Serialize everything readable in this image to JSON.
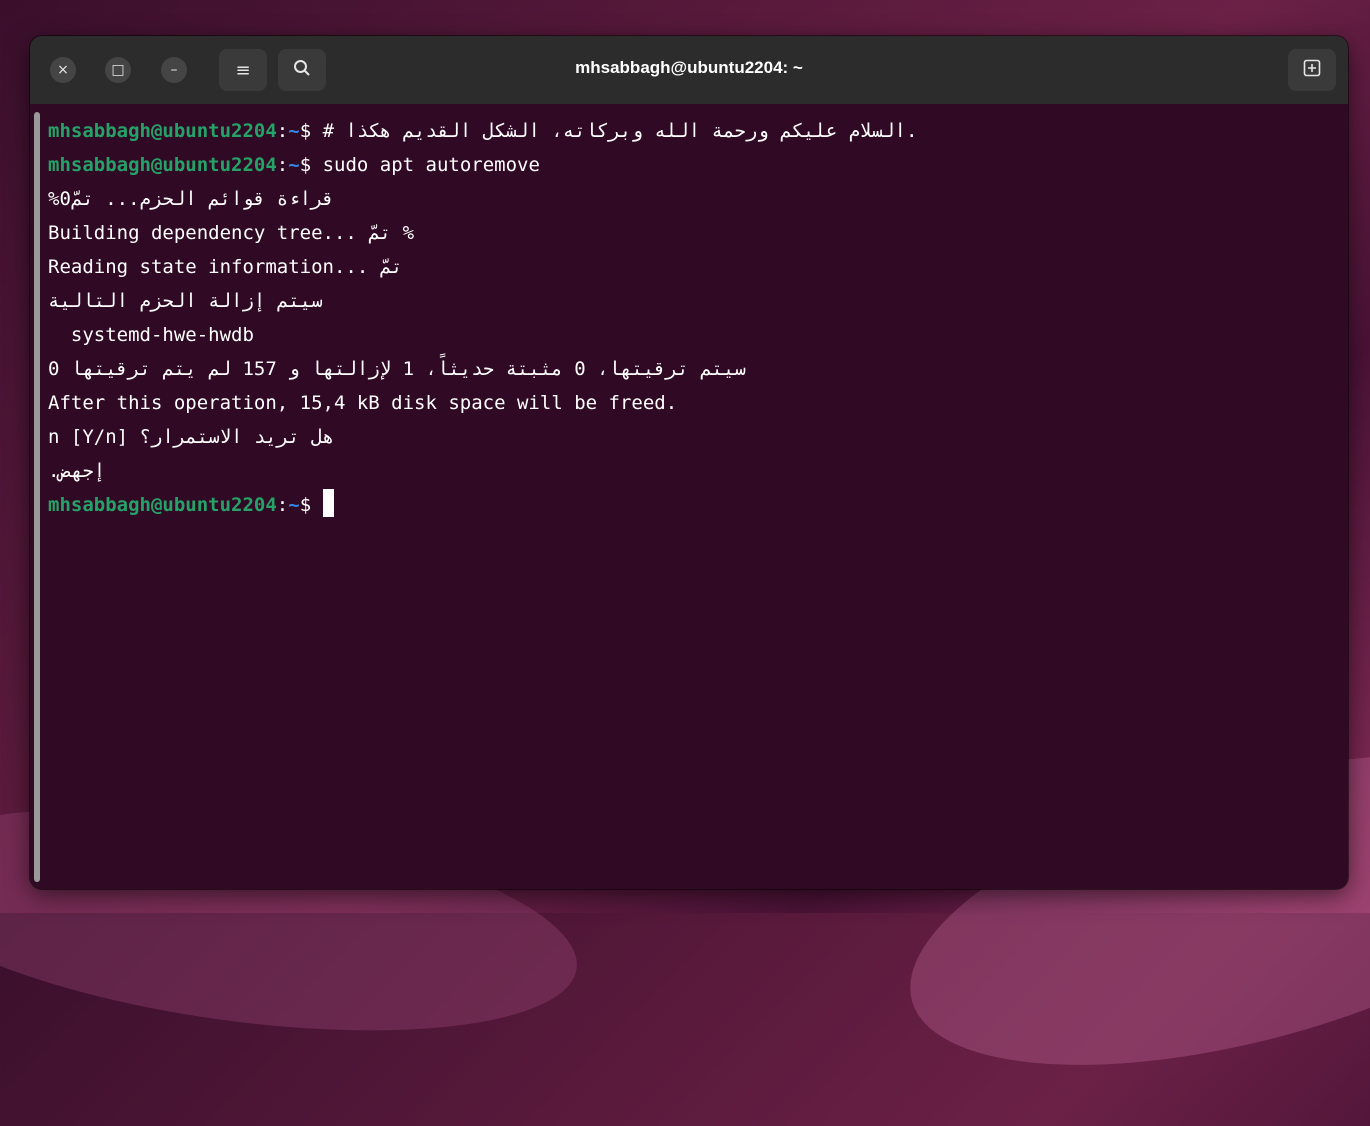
{
  "window": {
    "title": "mhsabbagh@ubuntu2204: ~",
    "buttons": {
      "close_icon": "×",
      "maximize_icon": "□",
      "minimize_icon": "–",
      "menu_icon": "≡",
      "search_icon": "⌕",
      "new_tab_icon": "⊞"
    }
  },
  "colors": {
    "terminal_bg": "#300a24",
    "titlebar_bg": "#2c2c2c",
    "prompt_user": "#26a269",
    "prompt_path": "#3584e4",
    "text": "#ffffff"
  },
  "terminal": {
    "prompt_user": "mhsabbagh@ubuntu2204",
    "prompt_sep": ":",
    "prompt_path": "~",
    "prompt_symbol": "$",
    "command1": " # السلام عليكم ورحمة الله وبركاته، الشكل القديم هكذا.",
    "command2": " sudo apt autoremove",
    "output": [
      "قراءة قوائم الحزم... تمّ0%",
      "Building dependency tree... تمّ %",
      "Reading state information... تمّ",
      "سيتم إزالة الحزم التالية",
      "  systemd-hwe-hwdb",
      "سيتم ترقيتها، 0 مثبتة حديثاً، 1 لإزالتها و 157 لم يتم ترقيتها 0",
      "After this operation, 15,4 kB disk space will be freed.",
      "هل تريد الاستمرار؟ [Y/n] n",
      "إجهض."
    ]
  }
}
